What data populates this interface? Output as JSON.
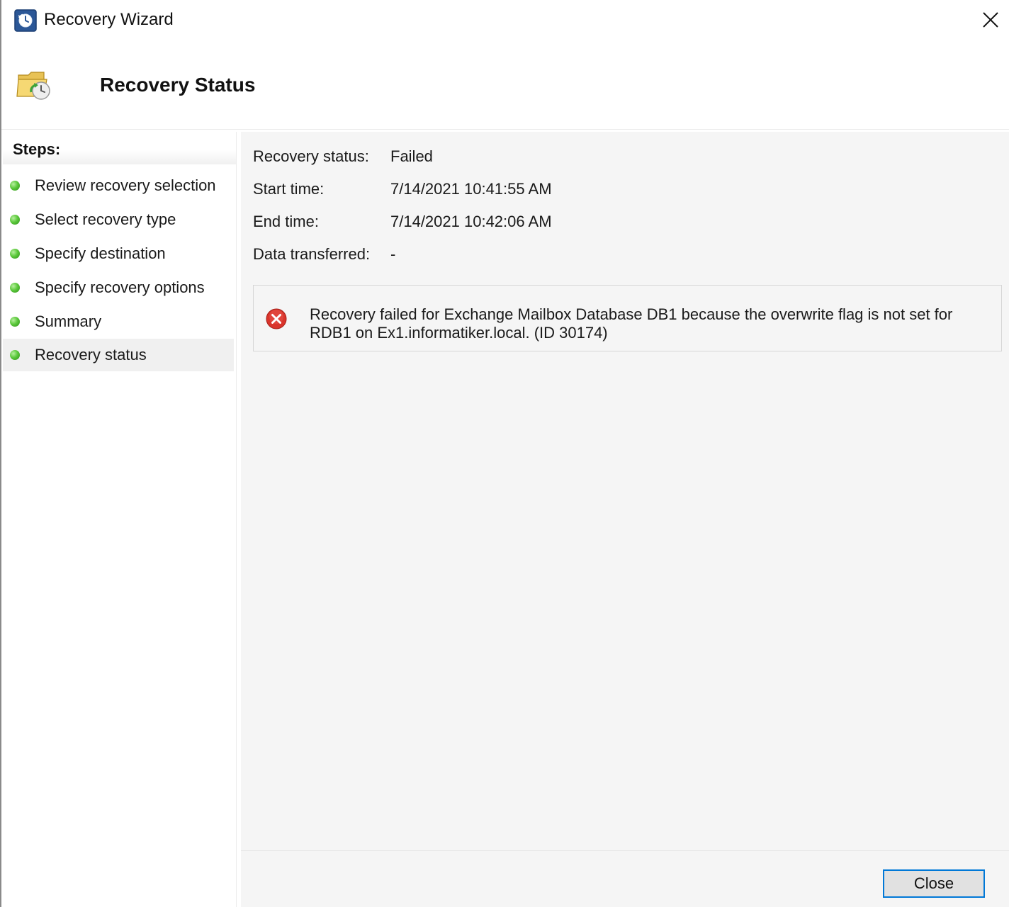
{
  "window": {
    "title": "Recovery Wizard",
    "app_icon": "backup-clock-icon",
    "close_icon": "close-icon"
  },
  "header": {
    "title": "Recovery Status",
    "icon": "folder-recovery-icon"
  },
  "steps": {
    "heading": "Steps:",
    "items": [
      {
        "label": "Review recovery selection",
        "status": "complete"
      },
      {
        "label": "Select recovery type",
        "status": "complete"
      },
      {
        "label": "Specify destination",
        "status": "complete"
      },
      {
        "label": "Specify recovery options",
        "status": "complete"
      },
      {
        "label": "Summary",
        "status": "complete"
      },
      {
        "label": "Recovery status",
        "status": "complete",
        "active": true
      }
    ]
  },
  "status": {
    "recovery_status_label": "Recovery status:",
    "recovery_status_value": "Failed",
    "start_time_label": "Start time:",
    "start_time_value": "7/14/2021 10:41:55 AM",
    "end_time_label": "End time:",
    "end_time_value": "7/14/2021 10:42:06 AM",
    "data_transferred_label": "Data transferred:",
    "data_transferred_value": "-"
  },
  "error": {
    "icon": "error-icon",
    "message": "Recovery failed for Exchange Mailbox Database DB1 because the overwrite flag is not set for RDB1 on Ex1.informatiker.local. (ID 30174)"
  },
  "footer": {
    "close_label": "Close"
  },
  "colors": {
    "accent": "#0078d7",
    "step_complete": "#4cbb2c",
    "error": "#d9342b",
    "panel_bg": "#f5f5f5"
  }
}
